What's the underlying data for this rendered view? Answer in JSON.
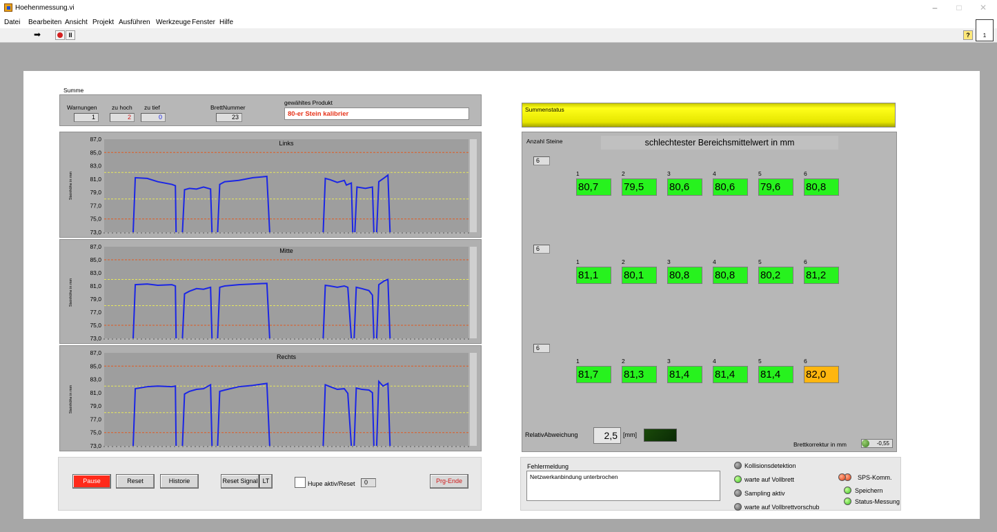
{
  "window": {
    "title": "Hoehenmessung.vi",
    "controls": [
      "–",
      "□",
      "✕"
    ]
  },
  "menu": [
    "Datei",
    "Bearbeiten",
    "Ansicht",
    "Projekt",
    "Ausführen",
    "Werkzeuge",
    "Fenster",
    "Hilfe"
  ],
  "toolbar": {
    "run_icon": "run-arrow-icon",
    "abort_icon": "abort-icon",
    "pause_icon": "pause-icon",
    "help": "?",
    "vi_icon_label": "1"
  },
  "summe": {
    "label": "Summe",
    "warnungen_label": "Warnungen",
    "warnungen": "1",
    "zuhoch_label": "zu hoch",
    "zuhoch": "2",
    "zutief_label": "zu tief",
    "zutief": "0",
    "brett_label": "BrettNummer",
    "brett": "23",
    "produkt_label": "gewähltes Produkt",
    "produkt": "80-er Stein kalibrier"
  },
  "charts": {
    "ylabel": "Steinhöhe in mm",
    "yticks": [
      "87,0",
      "85,0",
      "83,0",
      "81,0",
      "79,0",
      "77,0",
      "75,0",
      "73,0"
    ],
    "ylim": [
      73,
      87
    ],
    "red_limits": [
      85,
      75
    ],
    "yellow_limits": [
      82,
      78
    ],
    "panels": [
      {
        "title": "Links",
        "segments": [
          [
            [
              0,
              73
            ],
            [
              0.3,
              81.2
            ],
            [
              2,
              81.1
            ],
            [
              3.5,
              80.6
            ],
            [
              5.5,
              80.2
            ],
            [
              6,
              80
            ],
            [
              6.1,
              73
            ]
          ],
          [
            [
              7,
              73
            ],
            [
              7.3,
              79.4
            ],
            [
              8,
              79.6
            ],
            [
              9,
              79.5
            ],
            [
              10,
              79.8
            ],
            [
              11,
              79.5
            ],
            [
              11.2,
              73
            ]
          ],
          [
            [
              12,
              73
            ],
            [
              12.3,
              80.2
            ],
            [
              13,
              80.6
            ],
            [
              15,
              80.8
            ],
            [
              17,
              81.2
            ],
            [
              19,
              81.4
            ],
            [
              19.4,
              73
            ]
          ],
          [
            [
              27,
              73
            ],
            [
              27.3,
              81.1
            ],
            [
              28,
              80.9
            ],
            [
              29,
              80.5
            ],
            [
              30,
              80.8
            ],
            [
              30.3,
              80.1
            ],
            [
              31,
              80.4
            ],
            [
              31.2,
              73
            ]
          ],
          [
            [
              31.5,
              73
            ],
            [
              31.8,
              79.8
            ],
            [
              33,
              79.6
            ],
            [
              34,
              79.8
            ],
            [
              34.2,
              73
            ]
          ],
          [
            [
              34.6,
              73
            ],
            [
              34.9,
              80.6
            ],
            [
              35.7,
              81.2
            ],
            [
              36.2,
              81.6
            ],
            [
              36.5,
              73
            ]
          ]
        ]
      },
      {
        "title": "Mitte",
        "segments": [
          [
            [
              0,
              73
            ],
            [
              0.3,
              81.2
            ],
            [
              2,
              81.3
            ],
            [
              3.5,
              81.1
            ],
            [
              5.5,
              81.2
            ],
            [
              6,
              81
            ],
            [
              6.1,
              73
            ]
          ],
          [
            [
              7,
              73
            ],
            [
              7.3,
              79.8
            ],
            [
              8,
              80.2
            ],
            [
              9,
              80.6
            ],
            [
              10,
              80.5
            ],
            [
              11,
              80.8
            ],
            [
              11.2,
              73
            ]
          ],
          [
            [
              12,
              73
            ],
            [
              12.3,
              80.8
            ],
            [
              13,
              81
            ],
            [
              15,
              81.2
            ],
            [
              17,
              81.3
            ],
            [
              19,
              81.4
            ],
            [
              19.4,
              73
            ]
          ],
          [
            [
              27,
              73
            ],
            [
              27.3,
              81.1
            ],
            [
              28,
              81
            ],
            [
              29,
              80.8
            ],
            [
              30,
              81
            ],
            [
              30.5,
              80.8
            ],
            [
              31,
              73
            ]
          ],
          [
            [
              31.4,
              73
            ],
            [
              31.7,
              80.8
            ],
            [
              32.5,
              80.6
            ],
            [
              33.5,
              80.3
            ],
            [
              34,
              79.6
            ],
            [
              34.2,
              73
            ]
          ],
          [
            [
              34.6,
              73
            ],
            [
              34.9,
              81.2
            ],
            [
              35.7,
              81.8
            ],
            [
              36.2,
              82
            ],
            [
              36.5,
              73
            ]
          ]
        ]
      },
      {
        "title": "Rechts",
        "segments": [
          [
            [
              0,
              73
            ],
            [
              0.3,
              81.6
            ],
            [
              2,
              81.9
            ],
            [
              3.5,
              82
            ],
            [
              5.5,
              81.9
            ],
            [
              6,
              82
            ],
            [
              6.1,
              73
            ]
          ],
          [
            [
              7,
              73
            ],
            [
              7.3,
              80.8
            ],
            [
              8,
              81.2
            ],
            [
              9,
              81.5
            ],
            [
              10,
              81.6
            ],
            [
              11,
              82.2
            ],
            [
              11.2,
              73
            ]
          ],
          [
            [
              12,
              73
            ],
            [
              12.3,
              81.2
            ],
            [
              13,
              81.4
            ],
            [
              15,
              81.9
            ],
            [
              17,
              82.1
            ],
            [
              19,
              82.4
            ],
            [
              19.4,
              73
            ]
          ],
          [
            [
              27,
              73
            ],
            [
              27.3,
              82.2
            ],
            [
              28,
              81.9
            ],
            [
              29,
              81.5
            ],
            [
              30,
              81.6
            ],
            [
              30.5,
              80.9
            ],
            [
              31,
              73
            ]
          ],
          [
            [
              31.4,
              73
            ],
            [
              31.7,
              81.7
            ],
            [
              32.5,
              81.5
            ],
            [
              33.5,
              81.4
            ],
            [
              34,
              81
            ],
            [
              34.2,
              73
            ]
          ],
          [
            [
              34.6,
              73
            ],
            [
              34.9,
              82.7
            ],
            [
              35.5,
              82
            ],
            [
              36.2,
              82.4
            ],
            [
              36.5,
              73
            ]
          ]
        ]
      }
    ]
  },
  "chart_data": [
    {
      "type": "line",
      "title": "Links",
      "ylabel": "Steinhöhe in mm",
      "ylim": [
        73,
        87
      ],
      "series": [
        {
          "values": [
            81.1,
            79.6,
            81.0,
            80.6,
            79.6,
            81.4
          ]
        }
      ]
    },
    {
      "type": "line",
      "title": "Mitte",
      "ylabel": "Steinhöhe in mm",
      "ylim": [
        73,
        87
      ],
      "series": [
        {
          "values": [
            81.2,
            80.4,
            81.2,
            80.9,
            80.4,
            81.8
          ]
        }
      ]
    },
    {
      "type": "line",
      "title": "Rechts",
      "ylabel": "Steinhöhe in mm",
      "ylim": [
        73,
        87
      ],
      "series": [
        {
          "values": [
            81.9,
            81.5,
            81.9,
            81.5,
            81.4,
            82.3
          ]
        }
      ]
    }
  ],
  "buttons": {
    "pause": "Pause",
    "reset": "Reset",
    "historie": "Historie",
    "reset_signal": "Reset Signal",
    "lt": "LT",
    "hupe": "Hupe aktiv/Reset",
    "hupe_value": "0",
    "prg_ende": "Prg-Ende"
  },
  "status": {
    "summenstatus": "Summenstatus",
    "anzahl_steine": "Anzahl Steine",
    "heading": "schlechtester Bereichsmittelwert in mm"
  },
  "rows": [
    {
      "count": "6",
      "numbers": [
        "1",
        "2",
        "3",
        "4",
        "5",
        "6"
      ],
      "values": [
        "80,7",
        "79,5",
        "80,6",
        "80,6",
        "79,6",
        "80,8"
      ],
      "warn": [
        false,
        false,
        false,
        false,
        false,
        false
      ]
    },
    {
      "count": "6",
      "numbers": [
        "1",
        "2",
        "3",
        "4",
        "5",
        "6"
      ],
      "values": [
        "81,1",
        "80,1",
        "80,8",
        "80,8",
        "80,2",
        "81,2"
      ],
      "warn": [
        false,
        false,
        false,
        false,
        false,
        false
      ]
    },
    {
      "count": "6",
      "numbers": [
        "1",
        "2",
        "3",
        "4",
        "5",
        "6"
      ],
      "values": [
        "81,7",
        "81,3",
        "81,4",
        "81,4",
        "81,4",
        "82,0"
      ],
      "warn": [
        false,
        false,
        false,
        false,
        false,
        true
      ]
    }
  ],
  "relativ": {
    "label": "RelativAbweichung",
    "value": "2,5",
    "unit": "[mm]"
  },
  "brettkorrektur": {
    "label": "Brettkorrektur in mm",
    "value": "-0,55"
  },
  "fehler": {
    "label": "Fehlermeldung",
    "text": "Netzwerkanbindung unterbrochen"
  },
  "leds": [
    {
      "label": "Kollisionsdetektion",
      "state": "off"
    },
    {
      "label": "warte auf Vollbrett",
      "state": "on"
    },
    {
      "label": "Sampling aktiv",
      "state": "off"
    },
    {
      "label": "warte auf Vollbrettvorschub",
      "state": "off"
    }
  ],
  "leds_right": [
    {
      "label": "SPS-Komm.",
      "state": "red"
    },
    {
      "label": "Speichern",
      "state": "on"
    },
    {
      "label": "Status-Messung",
      "state": "on"
    }
  ],
  "colors": {
    "ok": "#27f21e",
    "warn": "#ffb60f",
    "pause": "#ff2a1a",
    "summenstatus": "#e6e600",
    "trace": "#1a25e6"
  }
}
